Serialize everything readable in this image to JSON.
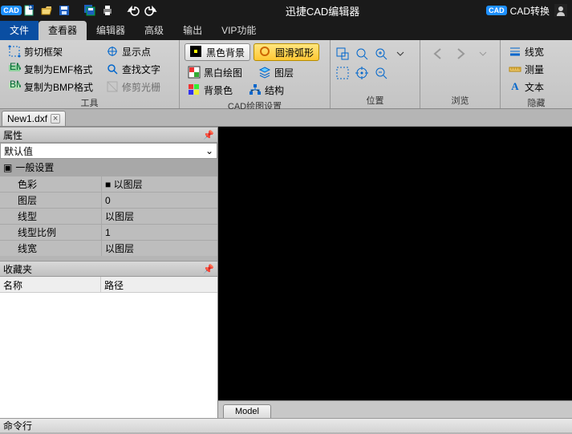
{
  "titlebar": {
    "app_title": "迅捷CAD编辑器",
    "cad_convert": "CAD转换"
  },
  "menu": {
    "file": "文件",
    "viewer": "查看器",
    "editor": "编辑器",
    "advanced": "高级",
    "output": "输出",
    "vip": "VIP功能"
  },
  "ribbon": {
    "tools": {
      "clip_frame": "剪切框架",
      "copy_emf": "复制为EMF格式",
      "copy_bmp": "复制为BMP格式",
      "show_point": "显示点",
      "find_text": "查找文字",
      "trim_aura": "修剪光栅",
      "group_label": "工具"
    },
    "draw": {
      "black_bg": "黑色背景",
      "smooth_arc": "圆滑弧形",
      "bw_draw": "黑白绘图",
      "layers": "图层",
      "bg_color": "背景色",
      "structure": "结构",
      "group_label": "CAD绘图设置"
    },
    "position": {
      "group_label": "位置"
    },
    "browse": {
      "group_label": "浏览"
    },
    "side": {
      "linewidth": "线宽",
      "measure": "测量",
      "text": "文本",
      "hide": "隐藏"
    }
  },
  "doc_tab": {
    "name": "New1.dxf"
  },
  "panels": {
    "props_title": "属性",
    "default_value": "默认值",
    "general_section": "一般设置",
    "rows": [
      {
        "k": "色彩",
        "v": "■ 以图层"
      },
      {
        "k": "图层",
        "v": "0"
      },
      {
        "k": "线型",
        "v": "以图层"
      },
      {
        "k": "线型比例",
        "v": "1"
      },
      {
        "k": "线宽",
        "v": "以图层"
      }
    ],
    "fav_title": "收藏夹",
    "fav_cols": {
      "name": "名称",
      "path": "路径"
    }
  },
  "model_tab": "Model",
  "status": "命令行"
}
